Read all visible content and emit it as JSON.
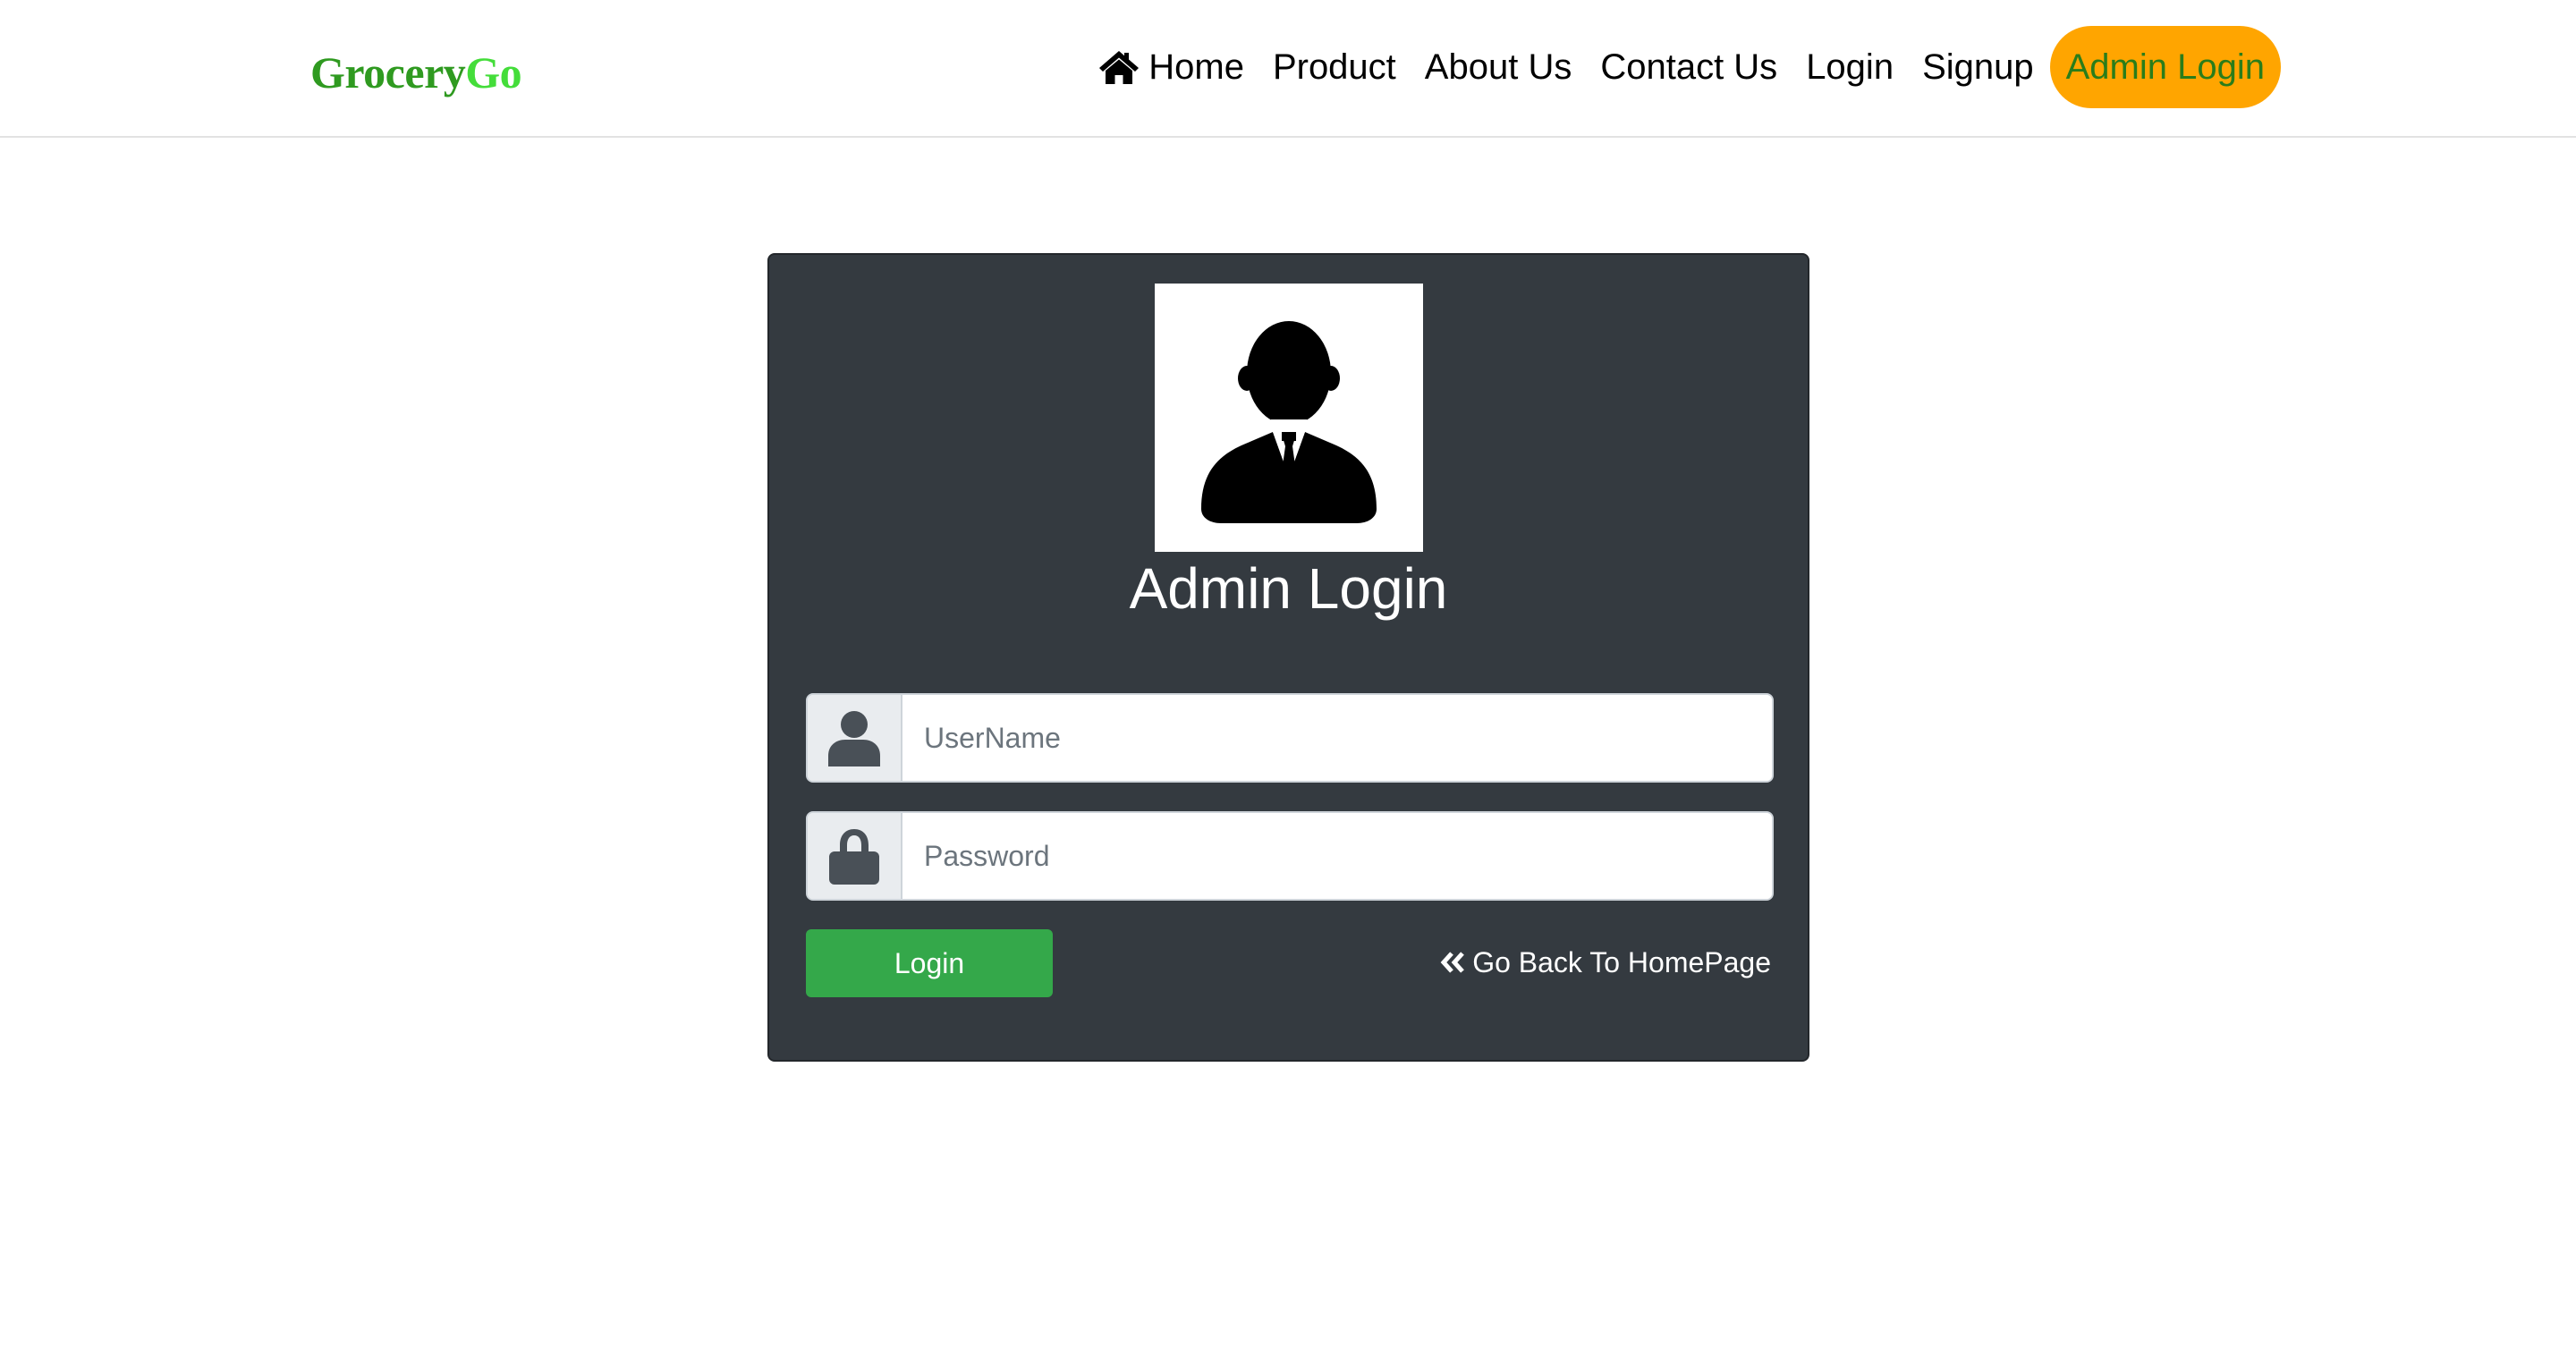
{
  "brand": {
    "part1": "Grocery",
    "part2": "Go"
  },
  "nav": {
    "items": [
      {
        "label": "Home",
        "icon": "home-icon"
      },
      {
        "label": "Product"
      },
      {
        "label": "About Us"
      },
      {
        "label": "Contact Us"
      },
      {
        "label": "Login"
      },
      {
        "label": "Signup"
      },
      {
        "label": "Admin Login",
        "active": true
      }
    ]
  },
  "card": {
    "avatar_icon": "admin-avatar-icon",
    "title": "Admin Login",
    "username": {
      "placeholder": "UserName",
      "value": "",
      "icon": "user-icon"
    },
    "password": {
      "placeholder": "Password",
      "value": "",
      "icon": "lock-icon"
    },
    "login_button": "Login",
    "back_link": {
      "label": "Go Back To HomePage",
      "icon": "double-chevron-left-icon"
    }
  },
  "colors": {
    "brand_dark": "#2f9a20",
    "brand_light": "#44dd3a",
    "active_nav_bg": "#ffa500",
    "active_nav_text": "#2a7d1a",
    "card_bg": "#343a40",
    "login_button_bg": "#34a84a"
  }
}
